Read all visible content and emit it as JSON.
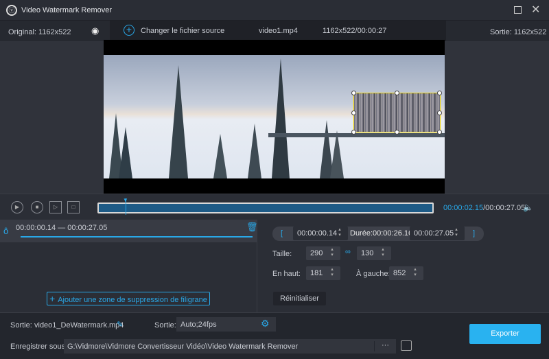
{
  "app": {
    "title": "Video Watermark Remover"
  },
  "header": {
    "original": "Original: 1162x522",
    "change_source": "Changer le fichier source",
    "filename": "video1.mp4",
    "info": "1162x522/00:00:27",
    "output": "Sortie: 1162x522"
  },
  "player": {
    "current_time": "00:00:02.15",
    "total_time": "/00:00:27.05",
    "progress": 0.08
  },
  "segment": {
    "range": "00:00:00.14 — 00:00:27.05"
  },
  "zone": {
    "start": "00:00:00.14",
    "duration": "Durée:00:00:26.16",
    "end": "00:00:27.05",
    "size_label": "Taille:",
    "width": "290",
    "height": "130",
    "top_label": "En haut:",
    "top": "181",
    "left_label": "À gauche:",
    "left": "852",
    "reset": "Réinitialiser",
    "add_zone": "Ajouter une zone de suppression de filigrane"
  },
  "output": {
    "name_label": "Sortie:",
    "name": "video1_DeWatermark.mp4",
    "format_label": "Sortie:",
    "format": "Auto;24fps",
    "save_label": "Enregistrer sous:",
    "path": "G:\\Vidmore\\Vidmore Convertisseur Vidéo\\Video Watermark Remover",
    "more": "···",
    "export": "Exporter"
  },
  "colors": {
    "accent": "#29a8e8",
    "selection": "#f2d600"
  }
}
